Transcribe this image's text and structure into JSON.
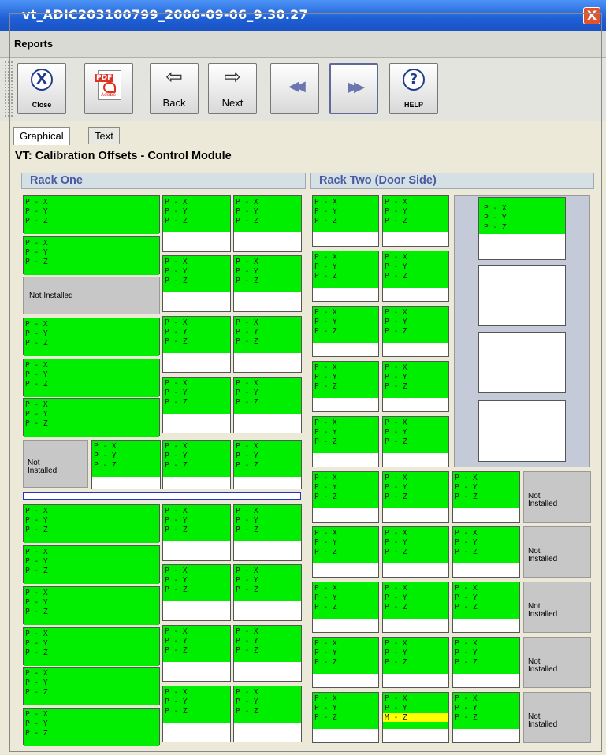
{
  "window": {
    "title": "vt_ADIC203100799_2006-09-06_9.30.27",
    "close_glyph": "X"
  },
  "menu": {
    "reports": "Reports"
  },
  "toolbar": {
    "close": "Close",
    "pdf_tag": "PDF",
    "pdf_brand": "Adobe",
    "back": "Back",
    "next": "Next",
    "help": "HELP",
    "close_glyph": "X",
    "back_glyph": "⇦",
    "next_glyph": "⇨",
    "first_glyph": "◀◀",
    "last_glyph": "▶▶",
    "help_glyph": "?"
  },
  "tabs": {
    "graphical": "Graphical",
    "text": "Text"
  },
  "section": {
    "title": "VT: Calibration Offsets - Control Module"
  },
  "racks": {
    "one": "Rack One",
    "two": "Rack Two (Door Side)"
  },
  "labels": {
    "px": "P - X",
    "py": "P - Y",
    "pz": "P - Z",
    "mz": "M - Z",
    "not_installed": "Not Installed",
    "not": "Not",
    "installed": "Installed"
  },
  "colors": {
    "ok": "#00ee00",
    "warn": "#ffff00",
    "absent": "#c7c7c7",
    "title_blue": "#1f5fd6",
    "rack_header_text": "#4a5aa0"
  }
}
